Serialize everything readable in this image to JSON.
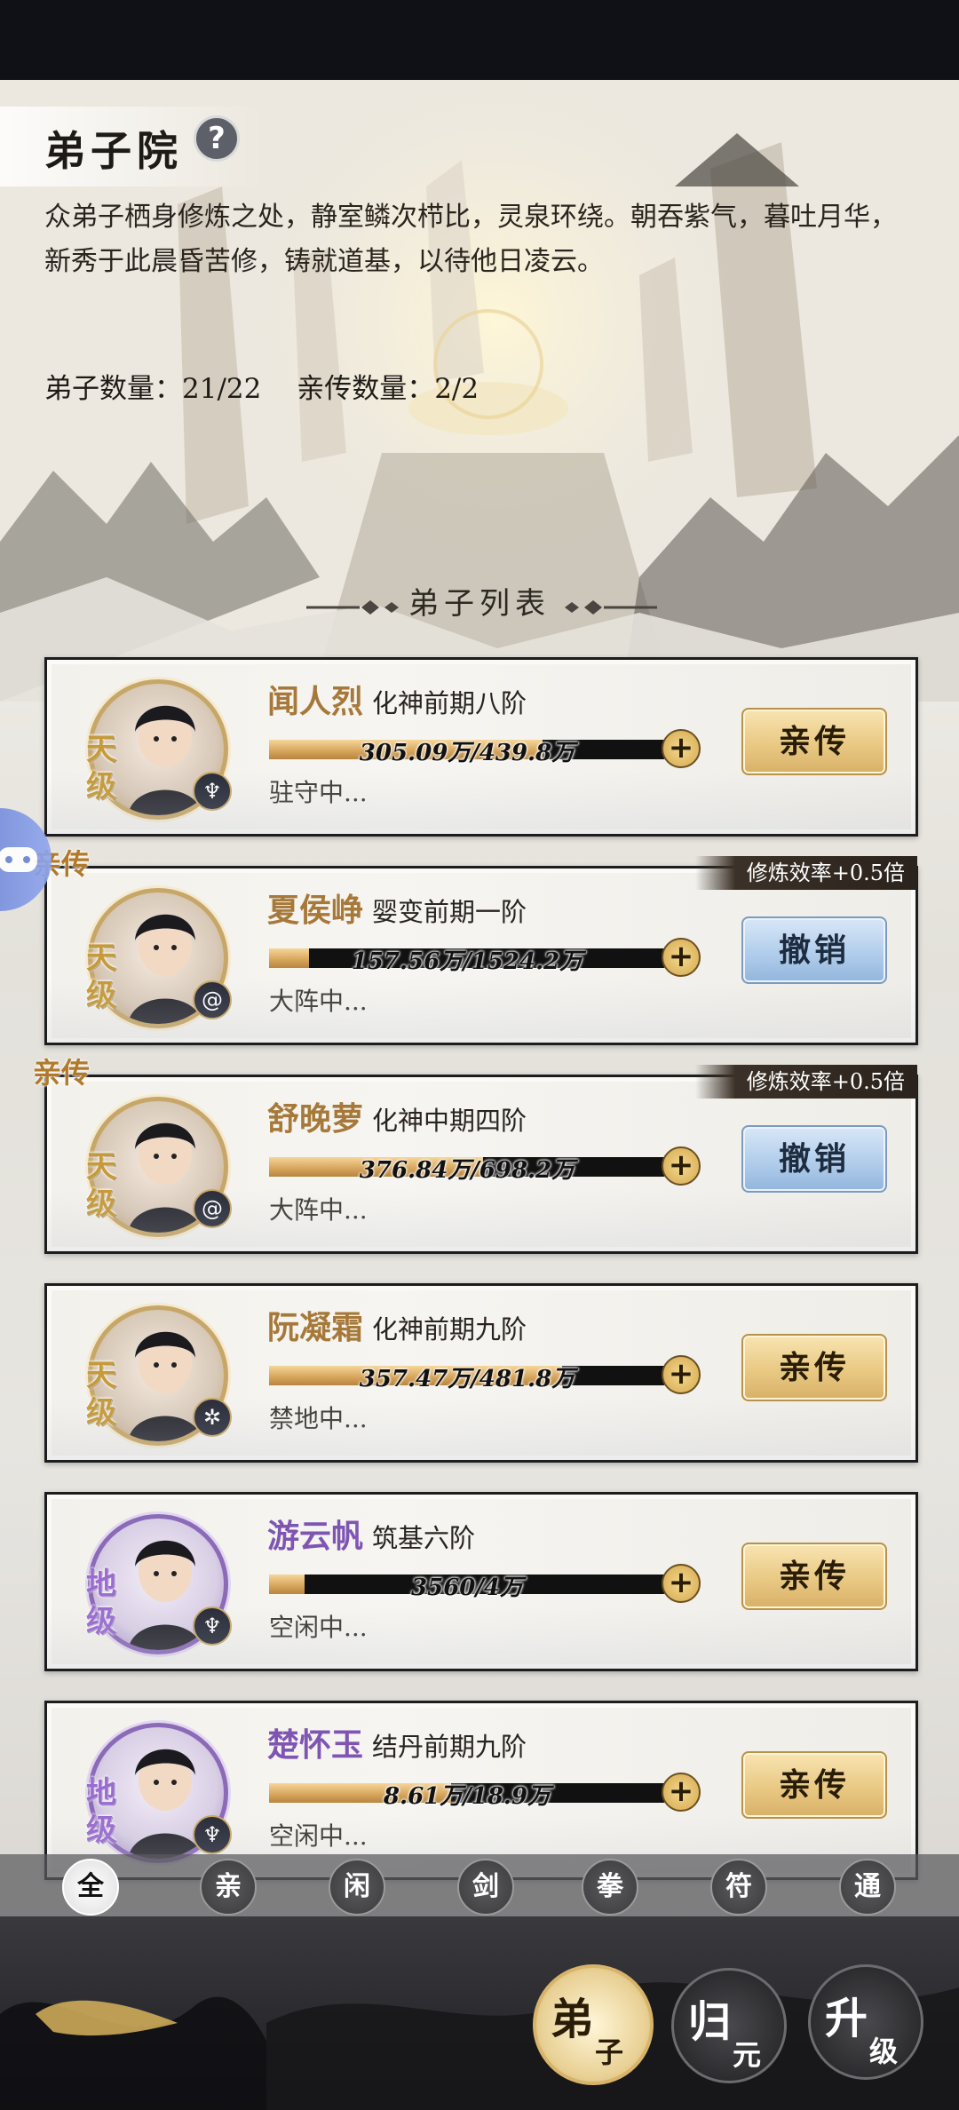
{
  "header": {
    "title": "弟子院",
    "help_symbol": "?",
    "description": "众弟子栖身修炼之处，静室鳞次栉比，灵泉环绕。朝吞紫气，暮吐月华，新秀于此晨昏苦修，铸就道基，以待他日凌云。",
    "disciple_count": "弟子数量：21/22",
    "direct_count": "亲传数量：2/2",
    "list_title": "弟子列表"
  },
  "disciples": [
    {
      "grade": "天级",
      "name": "闻人烈",
      "realm": "化神前期八阶",
      "exp_text": "305.09万/439.8万",
      "progress": 0.69,
      "status": "驻守中...",
      "action": "亲传",
      "direct": false,
      "badge": "",
      "element_icon": "sword-icon"
    },
    {
      "grade": "天级",
      "name": "夏侯峥",
      "realm": "婴变前期一阶",
      "exp_text": "157.56万/1524.2万",
      "progress": 0.1,
      "status": "大阵中...",
      "action": "撤销",
      "direct": true,
      "direct_tag": "亲传",
      "badge": "修炼效率+0.5倍",
      "element_icon": "spiral-icon"
    },
    {
      "grade": "天级",
      "name": "舒晚萝",
      "realm": "化神中期四阶",
      "exp_text": "376.84万/698.2万",
      "progress": 0.54,
      "status": "大阵中...",
      "action": "撤销",
      "direct": true,
      "direct_tag": "亲传",
      "badge": "修炼效率+0.5倍",
      "element_icon": "spiral-icon"
    },
    {
      "grade": "天级",
      "name": "阮凝霜",
      "realm": "化神前期九阶",
      "exp_text": "357.47万/481.8万",
      "progress": 0.74,
      "status": "禁地中...",
      "action": "亲传",
      "direct": false,
      "badge": "",
      "element_icon": "swirl-icon"
    },
    {
      "grade": "地级",
      "name": "游云帆",
      "realm": "筑基六阶",
      "exp_text": "3560/4万",
      "progress": 0.09,
      "status": "空闲中...",
      "action": "亲传",
      "direct": false,
      "badge": "",
      "element_icon": "sword-icon"
    },
    {
      "grade": "地级",
      "name": "楚怀玉",
      "realm": "结丹前期九阶",
      "exp_text": "8.61万/18.9万",
      "progress": 0.46,
      "status": "空闲中...",
      "action": "亲传",
      "direct": false,
      "badge": "",
      "element_icon": "sword-icon"
    }
  ],
  "filters": [
    "全",
    "亲",
    "闲",
    "剑",
    "拳",
    "符",
    "通"
  ],
  "active_filter": 0,
  "bottom_nav": {
    "dizi": [
      "弟",
      "子"
    ],
    "guiyuan": [
      "归",
      "元"
    ],
    "shengji": [
      "升",
      "级"
    ]
  },
  "colors": {
    "gold": "#c59a3a",
    "purple": "#8b6ab8",
    "blue_button": "#aecbea",
    "gold_button": "#e9c983"
  }
}
